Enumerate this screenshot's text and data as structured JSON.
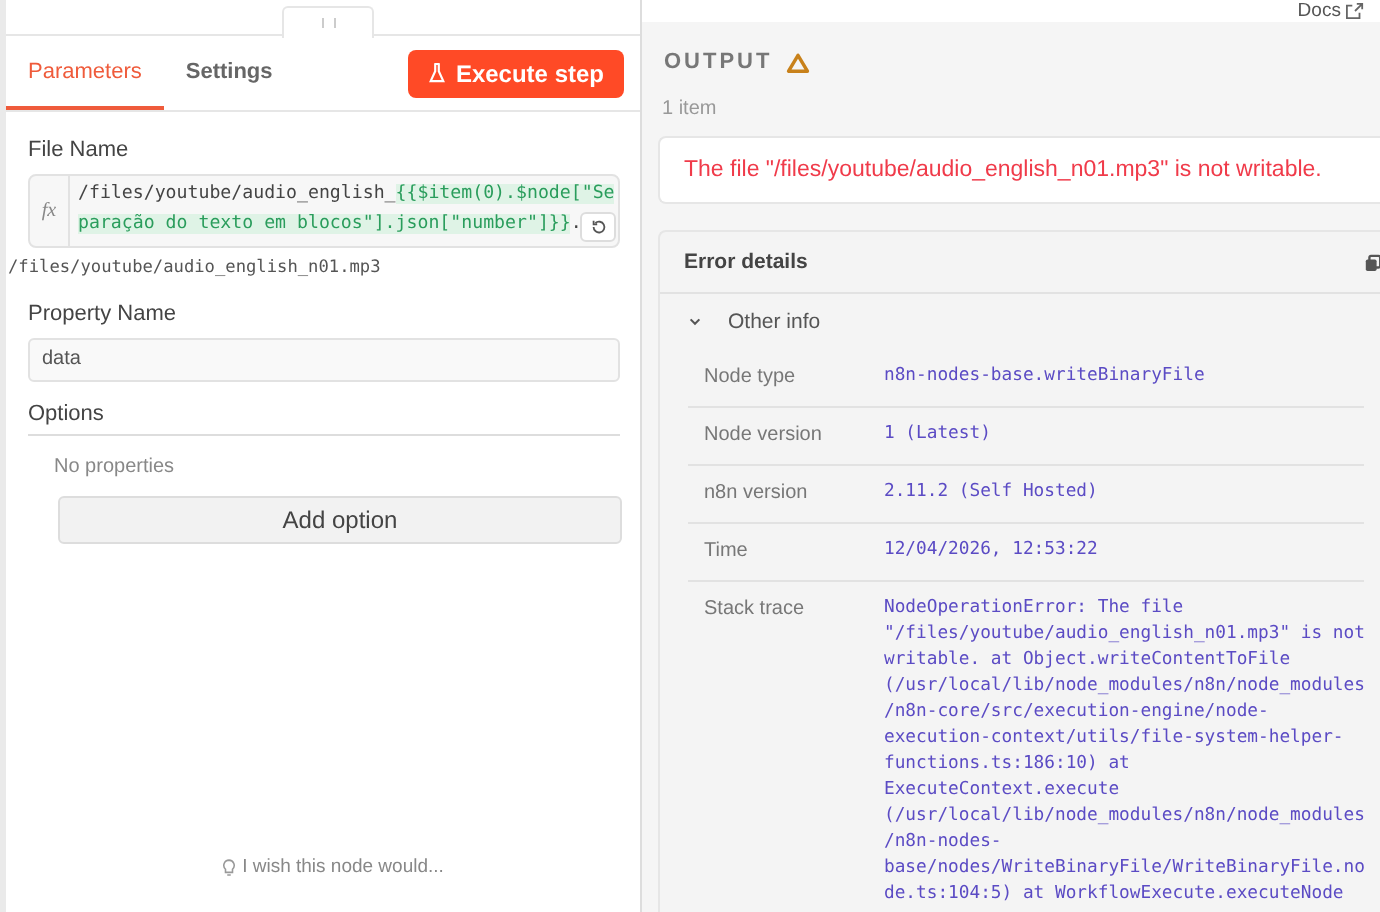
{
  "left_panel": {
    "tabs": [
      {
        "label": "Parameters",
        "selected": true
      },
      {
        "label": "Settings",
        "selected": false
      }
    ],
    "execute_button": {
      "label": "Execute step"
    },
    "file_name": {
      "label": "File Name",
      "gutter": "fx",
      "value_parts": [
        {
          "kind": "plain",
          "text": "/files/youtube/audio_english_"
        },
        {
          "kind": "expression",
          "text": "{{$item(0).$node[\"Separação do texto em blocos\"].json[\"number\"]}}"
        },
        {
          "kind": "plain",
          "text": "."
        }
      ],
      "preview": "/files/youtube/audio_english_n01.mp3"
    },
    "property_name": {
      "label": "Property Name",
      "value": "data"
    },
    "options": {
      "label": "Options",
      "empty_text": "No properties",
      "add_button": "Add option"
    },
    "feedback": "I wish this node would..."
  },
  "right_panel": {
    "docs_link": "Docs",
    "output_title": "OUTPUT",
    "item_count": "1 item",
    "error_message": "The file \"/files/youtube/audio_english_n01.mp3\" is not writable.",
    "error_details": {
      "title": "Error details",
      "section": {
        "label": "Other info",
        "expanded": true
      },
      "rows": [
        {
          "label": "Node type",
          "lines": [
            "n8n-nodes-base.writeBinaryFile"
          ]
        },
        {
          "label": "Node version",
          "lines": [
            "1 (Latest)"
          ]
        },
        {
          "label": "n8n version",
          "lines": [
            "2.11.2 (Self Hosted)"
          ]
        },
        {
          "label": "Time",
          "lines": [
            "12/04/2026, 12:53:22"
          ]
        },
        {
          "label": "Stack trace",
          "lines": [
            "NodeOperationError: The file",
            "\"/files/youtube/audio_english_n01.mp3\" is not",
            "writable. at Object.writeContentToFile",
            "(/usr/local/lib/node_modules/n8n/node_modules",
            "/n8n-core/src/execution-engine/node-",
            "execution-context/utils/file-system-helper-",
            "functions.ts:186:10) at",
            "ExecuteContext.execute",
            "(/usr/local/lib/node_modules/n8n/node_modules",
            "/n8n-nodes-",
            "base/nodes/WriteBinaryFile/WriteBinaryFile.no",
            "de.ts:104:5) at WorkflowExecute.executeNode"
          ]
        }
      ]
    }
  }
}
